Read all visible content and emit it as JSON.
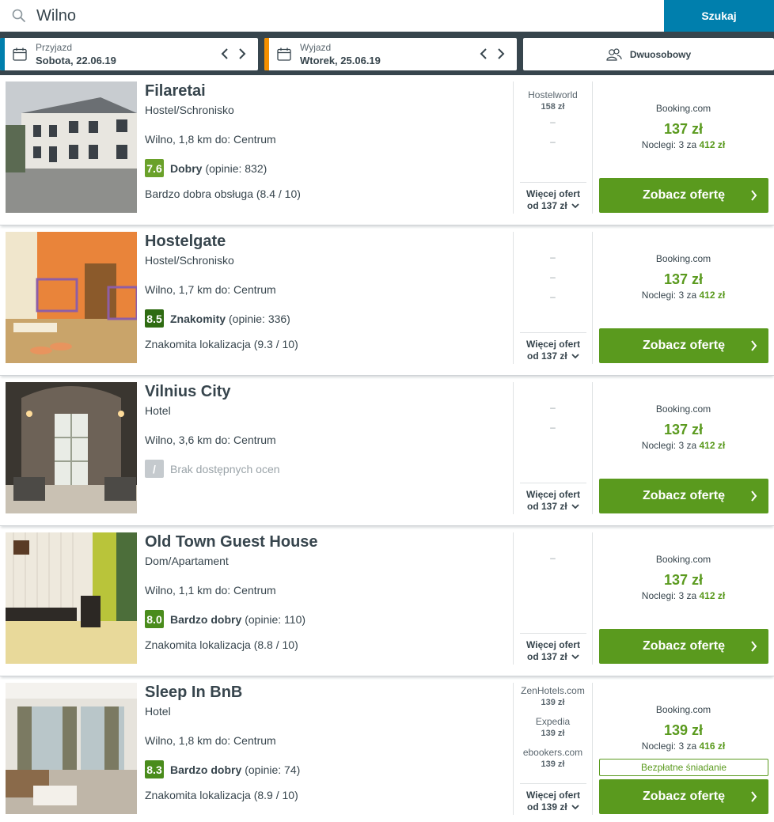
{
  "search": {
    "value": "Wilno",
    "button_label": "Szukaj"
  },
  "dates": {
    "checkin": {
      "label": "Przyjazd",
      "value": "Sobota, 22.06.19",
      "accent": "#007fad"
    },
    "checkout": {
      "label": "Wyjazd",
      "value": "Wtorek, 25.06.19",
      "accent": "#f48f00"
    },
    "room": {
      "label": "Dwuosobowy"
    }
  },
  "colors": {
    "primary": "#007fad",
    "dark": "#37454d",
    "green": "#5a9a1e",
    "score_green": "#4a8c1c",
    "score_dark": "#2f6b12",
    "score_na": "#c5cace"
  },
  "results": [
    {
      "name": "Filaretai",
      "type": "Hostel/Schronisko",
      "location": "Wilno, 1,8 km do: Centrum",
      "score": "7.6",
      "score_color": "#6aa12a",
      "rating_label": "Dobry",
      "rating_count": "(opinie: 832)",
      "highlight": "Bardzo dobra obsługa (8.4 / 10)",
      "alts": [
        {
          "site": "Hostelworld",
          "price": "158 zł"
        }
      ],
      "dashes": [
        "–",
        "–"
      ],
      "more_line1": "Więcej ofert",
      "more_line2": "od 137 zł",
      "deal_site": "Booking.com",
      "deal_price": "137 zł",
      "nights_prefix": "Noclegi: 3 za",
      "nights_total": "412 zł",
      "cta": "Zobacz ofertę",
      "freebie": ""
    },
    {
      "name": "Hostelgate",
      "type": "Hostel/Schronisko",
      "location": "Wilno, 1,7 km do: Centrum",
      "score": "8.5",
      "score_color": "#2f6b12",
      "rating_label": "Znakomity",
      "rating_count": "(opinie: 336)",
      "highlight": "Znakomita lokalizacja (9.3 / 10)",
      "alts": [],
      "dashes": [
        "–",
        "–",
        "–"
      ],
      "more_line1": "Więcej ofert",
      "more_line2": "od 137 zł",
      "deal_site": "Booking.com",
      "deal_price": "137 zł",
      "nights_prefix": "Noclegi: 3 za",
      "nights_total": "412 zł",
      "cta": "Zobacz ofertę",
      "freebie": ""
    },
    {
      "name": "Vilnius City",
      "type": "Hotel",
      "location": "Wilno, 3,6 km do: Centrum",
      "score": "/",
      "score_color": "#c5cace",
      "rating_label": "",
      "rating_count": "Brak dostępnych ocen",
      "highlight": "",
      "alts": [],
      "dashes": [
        "–",
        "–"
      ],
      "more_line1": "Więcej ofert",
      "more_line2": "od 137 zł",
      "deal_site": "Booking.com",
      "deal_price": "137 zł",
      "nights_prefix": "Noclegi: 3 za",
      "nights_total": "412 zł",
      "cta": "Zobacz ofertę",
      "freebie": ""
    },
    {
      "name": "Old Town Guest House",
      "type": "Dom/Apartament",
      "location": "Wilno, 1,1 km do: Centrum",
      "score": "8.0",
      "score_color": "#4a8c1c",
      "rating_label": "Bardzo dobry",
      "rating_count": "(opinie: 110)",
      "highlight": "Znakomita lokalizacja (8.8 / 10)",
      "alts": [],
      "dashes": [
        "–"
      ],
      "more_line1": "Więcej ofert",
      "more_line2": "od 137 zł",
      "deal_site": "Booking.com",
      "deal_price": "137 zł",
      "nights_prefix": "Noclegi: 3 za",
      "nights_total": "412 zł",
      "cta": "Zobacz ofertę",
      "freebie": ""
    },
    {
      "name": "Sleep In BnB",
      "type": "Hotel",
      "location": "Wilno, 1,8 km do: Centrum",
      "score": "8.3",
      "score_color": "#4a8c1c",
      "rating_label": "Bardzo dobry",
      "rating_count": "(opinie: 74)",
      "highlight": "Znakomita lokalizacja (8.9 / 10)",
      "alts": [
        {
          "site": "ZenHotels.com",
          "price": "139 zł"
        },
        {
          "site": "Expedia",
          "price": "139 zł"
        },
        {
          "site": "ebookers.com",
          "price": "139 zł"
        }
      ],
      "dashes": [],
      "more_line1": "Więcej ofert",
      "more_line2": "od 139 zł",
      "deal_site": "Booking.com",
      "deal_price": "139 zł",
      "nights_prefix": "Noclegi: 3 za",
      "nights_total": "416 zł",
      "cta": "Zobacz ofertę",
      "freebie": "Bezpłatne śniadanie"
    }
  ]
}
